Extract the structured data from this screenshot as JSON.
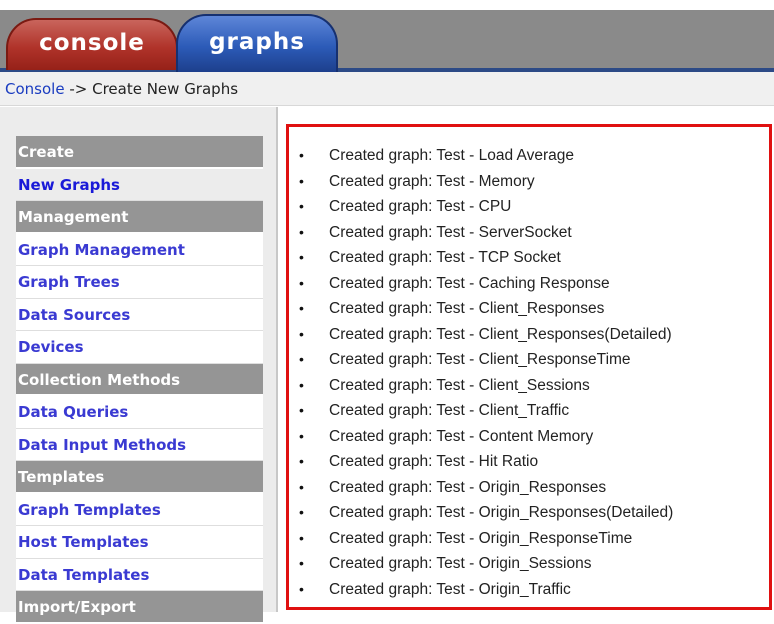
{
  "tabs": {
    "console": "console",
    "graphs": "graphs"
  },
  "breadcrumb": {
    "root": "Console",
    "arrow": "->",
    "current": "Create New Graphs"
  },
  "menu": [
    {
      "label": "Create",
      "type": "header"
    },
    {
      "label": "New Graphs",
      "type": "link",
      "active": true
    },
    {
      "label": "Management",
      "type": "header"
    },
    {
      "label": "Graph Management",
      "type": "link"
    },
    {
      "label": "Graph Trees",
      "type": "link"
    },
    {
      "label": "Data Sources",
      "type": "link"
    },
    {
      "label": "Devices",
      "type": "link"
    },
    {
      "label": "Collection Methods",
      "type": "header"
    },
    {
      "label": "Data Queries",
      "type": "link"
    },
    {
      "label": "Data Input Methods",
      "type": "link"
    },
    {
      "label": "Templates",
      "type": "header"
    },
    {
      "label": "Graph Templates",
      "type": "link"
    },
    {
      "label": "Host Templates",
      "type": "link"
    },
    {
      "label": "Data Templates",
      "type": "link"
    },
    {
      "label": "Import/Export",
      "type": "header"
    }
  ],
  "results": [
    "Created graph: Test - Load Average",
    "Created graph: Test - Memory",
    "Created graph: Test - CPU",
    "Created graph: Test - ServerSocket",
    "Created graph: Test - TCP Socket",
    "Created graph: Test - Caching Response",
    "Created graph: Test - Client_Responses",
    "Created graph: Test - Client_Responses(Detailed)",
    "Created graph: Test - Client_ResponseTime",
    "Created graph: Test - Client_Sessions",
    "Created graph: Test - Client_Traffic",
    "Created graph: Test - Content Memory",
    "Created graph: Test - Hit Ratio",
    "Created graph: Test - Origin_Responses",
    "Created graph: Test - Origin_Responses(Detailed)",
    "Created graph: Test - Origin_ResponseTime",
    "Created graph: Test - Origin_Sessions",
    "Created graph: Test - Origin_Traffic"
  ],
  "bullet": "•",
  "colors": {
    "console_tab": "#b0332a",
    "graphs_tab": "#2c5bb8",
    "menu_header": "#959595",
    "menu_link": "#3a3ad2",
    "result_border": "#e01010"
  }
}
